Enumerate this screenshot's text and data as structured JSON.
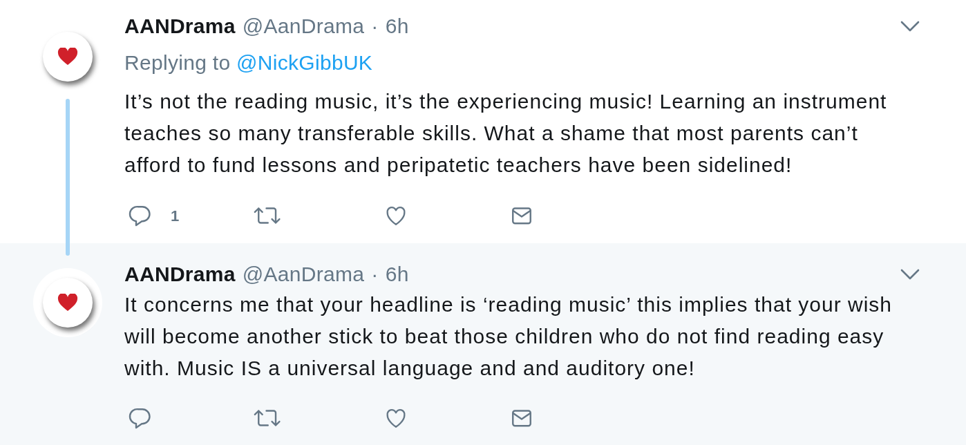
{
  "tweets": [
    {
      "highlighted": false,
      "thread_continues": true,
      "name": "AANDrama",
      "handle": "@AanDrama",
      "separator": "·",
      "time": "6h",
      "replying_to": {
        "label": "Replying to",
        "handle": "@NickGibbUK"
      },
      "text": "It’s not the reading music, it’s the experiencing music! Learning an instrument teaches so many transferable skills. What a shame that most parents can’t afford to fund lessons and peripatetic teachers have been sidelined!",
      "actions": [
        {
          "kind": "reply",
          "count": "1"
        },
        {
          "kind": "retweet"
        },
        {
          "kind": "like"
        },
        {
          "kind": "message"
        }
      ]
    },
    {
      "highlighted": true,
      "thread_continues": false,
      "name": "AANDrama",
      "handle": "@AanDrama",
      "separator": "·",
      "time": "6h",
      "text": "It concerns me that your headline is ‘reading music’ this implies that your wish will become another stick to beat those children who do not find reading easy with. Music IS a universal language and and auditory one!",
      "actions": [
        {
          "kind": "reply"
        },
        {
          "kind": "retweet"
        },
        {
          "kind": "like"
        },
        {
          "kind": "message"
        }
      ]
    }
  ]
}
